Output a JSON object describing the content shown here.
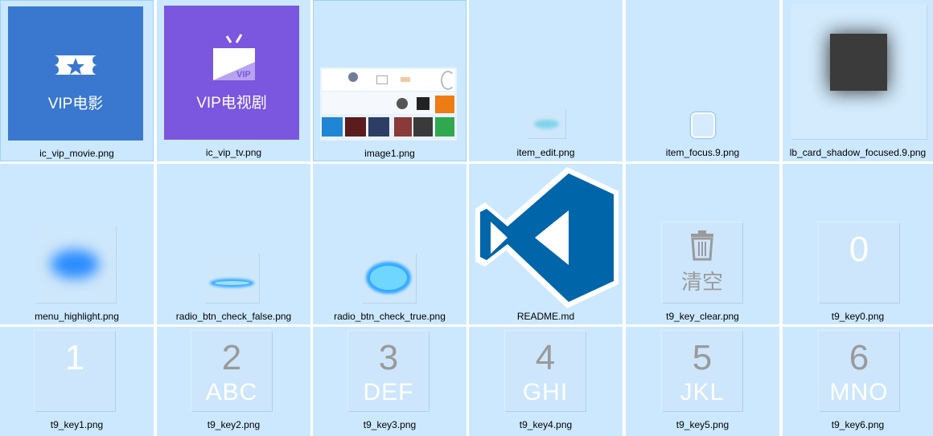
{
  "files": [
    {
      "name": "ic_vip_movie.png",
      "caption": "VIP电影"
    },
    {
      "name": "ic_vip_tv.png",
      "caption": "VIP电视剧"
    },
    {
      "name": "image1.png"
    },
    {
      "name": "item_edit.png"
    },
    {
      "name": "item_focus.9.png"
    },
    {
      "name": "lb_card_shadow_focused.9.png"
    },
    {
      "name": "menu_highlight.png"
    },
    {
      "name": "radio_btn_check_false.png"
    },
    {
      "name": "radio_btn_check_true.png"
    },
    {
      "name": "README.md"
    },
    {
      "name": "t9_key_clear.png",
      "caption": "清空"
    },
    {
      "name": "t9_key0.png",
      "digit": "0"
    },
    {
      "name": "t9_key1.png",
      "digit": "1"
    },
    {
      "name": "t9_key2.png",
      "digit": "2",
      "letters": "ABC"
    },
    {
      "name": "t9_key3.png",
      "digit": "3",
      "letters": "DEF"
    },
    {
      "name": "t9_key4.png",
      "digit": "4",
      "letters": "GHI"
    },
    {
      "name": "t9_key5.png",
      "digit": "5",
      "letters": "JKL"
    },
    {
      "name": "t9_key6.png",
      "digit": "6",
      "letters": "MNO"
    }
  ],
  "colors": {
    "tile_bg": "#cce8ff",
    "vip_movie": "#3a78cf",
    "vip_tv": "#7b56df",
    "vscode_blue": "#0065a9"
  }
}
